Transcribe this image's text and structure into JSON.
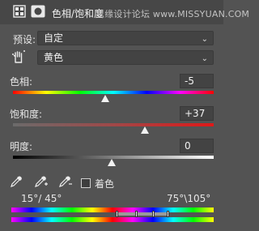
{
  "header": {
    "title": "色相/饱和度",
    "watermark": "思缘设计论坛 www.MISSYUAN.COM",
    "icons": [
      "adjustment-layer-icon",
      "mask-icon"
    ]
  },
  "preset": {
    "label": "预设:",
    "value": "自定"
  },
  "channel": {
    "value": "黄色",
    "icon": "hand-target-icon"
  },
  "hue": {
    "label": "色相:",
    "value": "-5",
    "level": -5
  },
  "saturation": {
    "label": "饱和度:",
    "value": "+37",
    "level": 37
  },
  "lightness": {
    "label": "明度:",
    "value": "0",
    "level": 0
  },
  "eyedroppers": [
    "eyedropper-icon",
    "eyedropper-plus-icon",
    "eyedropper-minus-icon"
  ],
  "colorize": {
    "label": "着色",
    "checked": false
  },
  "range": {
    "left": "15°/ 45°",
    "right": "75°\\105°"
  },
  "colors": {
    "panel_bg": "#535353",
    "header_bg": "#474747",
    "field_bg": "#434343"
  }
}
